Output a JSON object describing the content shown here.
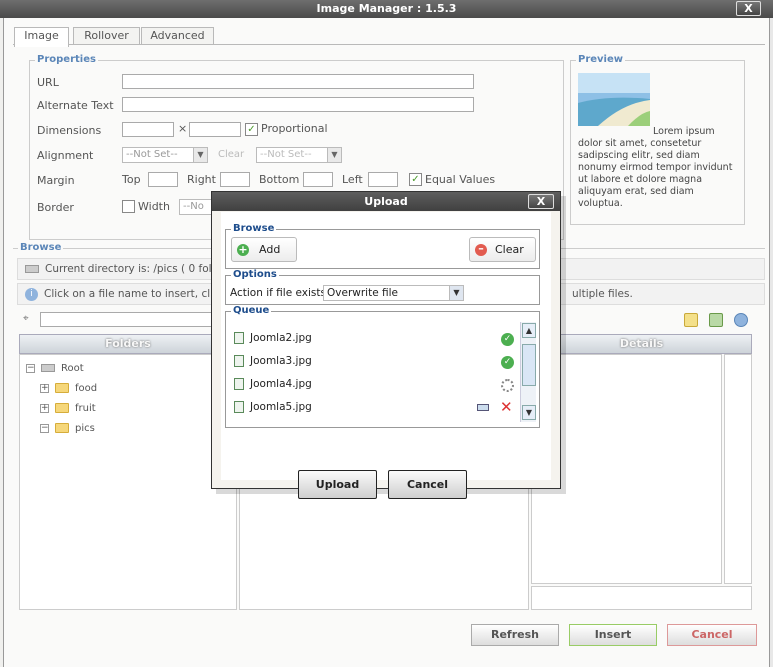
{
  "window": {
    "title": "Image Manager : 1.5.3",
    "close": "X"
  },
  "tabs": [
    {
      "label": "Image"
    },
    {
      "label": "Rollover"
    },
    {
      "label": "Advanced"
    }
  ],
  "properties": {
    "legend": "Properties",
    "url_label": "URL",
    "alt_label": "Alternate Text",
    "dimensions_label": "Dimensions",
    "times": "×",
    "proportional": "Proportional",
    "alignment_label": "Alignment",
    "not_set": "--Not Set--",
    "clear_label": "Clear",
    "margin_label": "Margin",
    "top": "Top",
    "right": "Right",
    "bottom": "Bottom",
    "left": "Left",
    "equal_values": "Equal Values",
    "border_label": "Border",
    "width_label": "Width",
    "width_value": "--No"
  },
  "preview": {
    "legend": "Preview",
    "text": "Lorem ipsum dolor sit amet, consetetur sadipscing elitr, sed diam nonumy eirmod tempor invidunt ut labore et dolore magna aliquyam erat, sed diam voluptua."
  },
  "browse": {
    "legend": "Browse",
    "current_dir": "Current directory is: /pics ( 0 fold",
    "info": "Click on a file name to insert, clic",
    "info_tail": "ultiple files.",
    "folders_header": "Folders",
    "details_header": "Details",
    "tree": [
      {
        "label": "Root",
        "toggle": "−"
      },
      {
        "label": "food",
        "toggle": "+"
      },
      {
        "label": "fruit",
        "toggle": "+"
      },
      {
        "label": "pics",
        "toggle": "−"
      }
    ]
  },
  "buttons": {
    "refresh": "Refresh",
    "insert": "Insert",
    "cancel": "Cancel"
  },
  "upload": {
    "title": "Upload",
    "close": "X",
    "browse_legend": "Browse",
    "add": "Add",
    "clear": "Clear",
    "options_legend": "Options",
    "action_label": "Action if file exists:",
    "action_value": "Overwrite file",
    "queue_legend": "Queue",
    "queue": [
      {
        "name": "Joomla2.jpg",
        "status": "done"
      },
      {
        "name": "Joomla3.jpg",
        "status": "done"
      },
      {
        "name": "Joomla4.jpg",
        "status": "uploading"
      },
      {
        "name": "Joomla5.jpg",
        "status": "pending"
      }
    ],
    "upload_btn": "Upload",
    "cancel_btn": "Cancel"
  }
}
